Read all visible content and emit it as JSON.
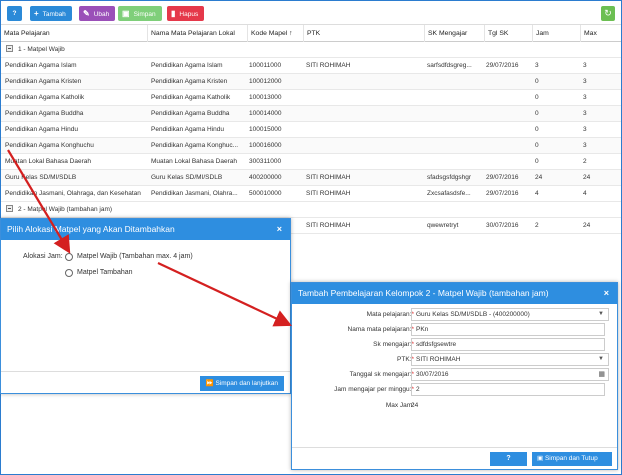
{
  "toolbar": {
    "help_label": "?",
    "add_label": "Tambah",
    "edit_label": "Ubah",
    "save_label": "Simpan",
    "delete_label": "Hapus",
    "refresh_icon": "↻"
  },
  "grid": {
    "columns": [
      "Mata Pelajaran",
      "Nama Mata Pelajaran Lokal",
      "Kode Mapel ↑",
      "PTK",
      "SK Mengajar",
      "Tgl SK",
      "Jam",
      "Max"
    ],
    "group1": "1 - Matpel Wajib",
    "rows": [
      [
        "Pendidikan Agama Islam",
        "Pendidikan Agama Islam",
        "100011000",
        "SITI ROHIMAH",
        "sarfsdfdsgreg...",
        "29/07/2016",
        "3",
        "3"
      ],
      [
        "Pendidikan Agama Kristen",
        "Pendidikan Agama Kristen",
        "100012000",
        "",
        "",
        "",
        "0",
        "3"
      ],
      [
        "Pendidikan Agama Katholik",
        "Pendidikan Agama Katholik",
        "100013000",
        "",
        "",
        "",
        "0",
        "3"
      ],
      [
        "Pendidikan Agama Buddha",
        "Pendidikan Agama Buddha",
        "100014000",
        "",
        "",
        "",
        "0",
        "3"
      ],
      [
        "Pendidikan Agama Hindu",
        "Pendidikan Agama Hindu",
        "100015000",
        "",
        "",
        "",
        "0",
        "3"
      ],
      [
        "Pendidikan Agama Konghuchu",
        "Pendidikan Agama Konghuc...",
        "100016000",
        "",
        "",
        "",
        "0",
        "3"
      ],
      [
        "Muatan Lokal Bahasa Daerah",
        "Muatan Lokal Bahasa Daerah",
        "300311000",
        "",
        "",
        "",
        "0",
        "2"
      ],
      [
        "Guru Kelas SD/MI/SDLB",
        "Guru Kelas SD/MI/SDLB",
        "400200000",
        "SITI ROHIMAH",
        "sfadsgsfdgshgr",
        "29/07/2016",
        "24",
        "24"
      ],
      [
        "Pendidikan Jasmani, Olahraga, dan Kesehatan",
        "Pendidikan Jasmani, Olahra...",
        "500010000",
        "SITI ROHIMAH",
        "Zxcsafasdsfe...",
        "29/07/2016",
        "4",
        "4"
      ]
    ],
    "group2": "2 - Matpel Wajib (tambahan jam)",
    "row_g2": [
      "",
      "",
      "",
      "SITI ROHIMAH",
      "qwewretryt",
      "30/07/2016",
      "2",
      "24"
    ]
  },
  "dialog1": {
    "title": "Pilih Alokasi Matpel yang Akan Ditambahkan",
    "close": "×",
    "label": "Alokasi Jam:",
    "option1": "Matpel Wajib (Tambahan max. 4 jam)",
    "option2": "Matpel Tambahan",
    "button": "Simpan dan lanjutkan"
  },
  "dialog2": {
    "title": "Tambah Pembelajaran Kelompok 2 - Matpel Wajib (tambahan jam)",
    "close": "×",
    "fields": {
      "mata_label": "Mata pelajaran:",
      "mata_value": "Guru Kelas SD/MI/SDLB - (400200000)",
      "nama_label": "Nama mata pelajaran:",
      "nama_value": "PKn",
      "sk_label": "Sk mengajar:",
      "sk_value": "sdfdsfgsewtre",
      "ptk_label": "PTK:",
      "ptk_value": "SITI ROHIMAH",
      "tgl_label": "Tanggal sk mengajar:",
      "tgl_value": "30/07/2016",
      "jam_label": "Jam mengajar per minggu:",
      "jam_value": "2",
      "max_label": "Max Jam:",
      "max_value": "24"
    },
    "required_mark": "*",
    "help_button": "?",
    "save_button": "Simpan dan Tutup"
  },
  "colors": {
    "primary": "#2e8ee0",
    "edit": "#9a4fb8",
    "save": "#7fcf7a",
    "delete": "#e5384a",
    "refresh": "#6cbf52",
    "arrow": "#d42020"
  }
}
